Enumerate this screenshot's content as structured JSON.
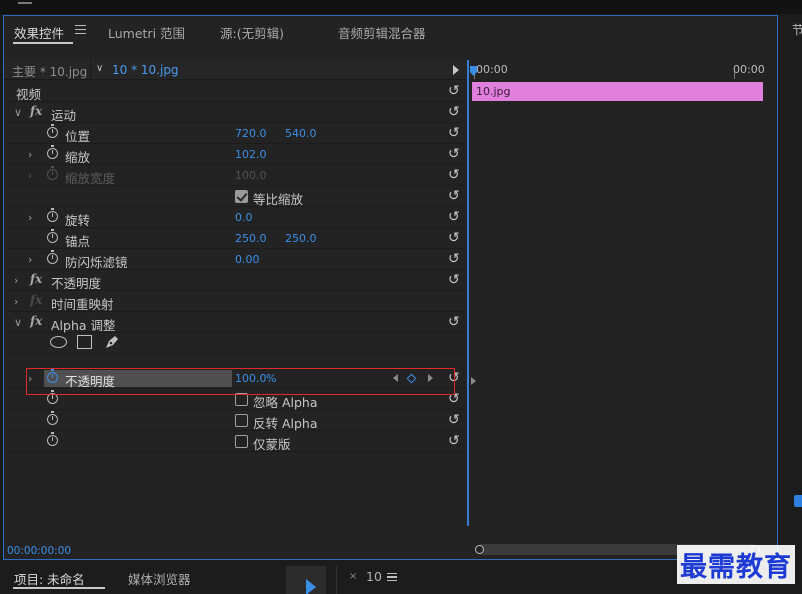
{
  "tabs": [
    {
      "label": "效果控件",
      "active": true
    },
    {
      "label": "Lumetri 范围",
      "active": false
    },
    {
      "label": "源:(无剪辑)",
      "active": false
    },
    {
      "label": "音频剪辑混合器",
      "active": false
    }
  ],
  "source_bar": {
    "master": "主要 * 10.jpg",
    "clip": "10 * 10.jpg"
  },
  "section": {
    "video": "视频"
  },
  "motion": {
    "label": "运动",
    "position": {
      "label": "位置",
      "x": "720.0",
      "y": "540.0"
    },
    "scale": {
      "label": "缩放",
      "value": "102.0"
    },
    "scale_width": {
      "label": "缩放宽度",
      "value": "100.0"
    },
    "uniform_scale": {
      "label": "等比缩放",
      "checked": true
    },
    "rotation": {
      "label": "旋转",
      "value": "0.0"
    },
    "anchor": {
      "label": "锚点",
      "x": "250.0",
      "y": "250.0"
    },
    "anti_flicker": {
      "label": "防闪烁滤镜",
      "value": "0.00"
    }
  },
  "opacity": {
    "label": "不透明度"
  },
  "time_remap": {
    "label": "时间重映射"
  },
  "alpha_adjust": {
    "label": "Alpha 调整",
    "opacity": {
      "label": "不透明度",
      "value": "100.0",
      "unit": "%"
    },
    "ignore_alpha": {
      "label": "忽略 Alpha",
      "checked": false
    },
    "invert_alpha": {
      "label": "反转 Alpha",
      "checked": false
    },
    "mask_only": {
      "label": "仅蒙版",
      "checked": false
    }
  },
  "timeline": {
    "start": "00:00",
    "end": "00:00",
    "clip_name": "10.jpg"
  },
  "timecode": "00:00:00:00",
  "right_panel_label": "节",
  "bottom": {
    "project_tab": "项目: 未命名",
    "media_browser_tab": "媒体浏览器",
    "close_glyph": "×",
    "sequence": "10"
  },
  "watermark": "最需教育",
  "icons": {
    "reset": "reset-icon",
    "stopwatch": "stopwatch-icon",
    "pen": "pen-icon",
    "menu": "hamburger-menu-icon"
  },
  "colors": {
    "accent": "#3b8ee6",
    "clip": "#e080dc",
    "highlight_box": "#e02a2a"
  }
}
